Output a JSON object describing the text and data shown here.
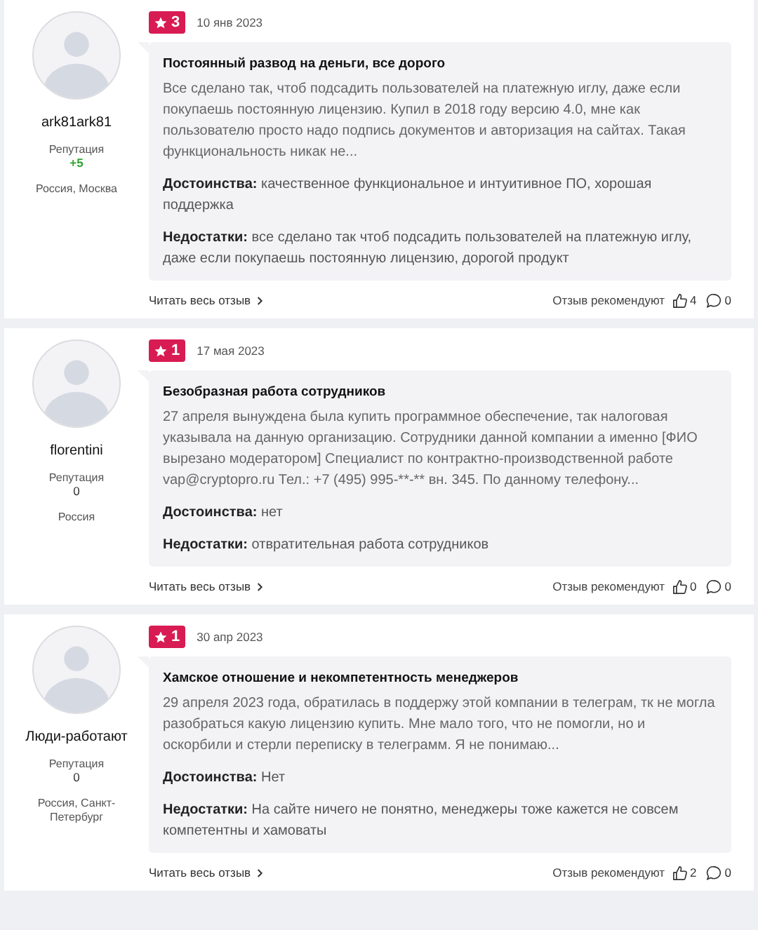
{
  "reviews": [
    {
      "author": "ark81ark81",
      "reputation_label": "Репутация",
      "reputation": "+5",
      "reputation_positive": true,
      "location": "Россия, Москва",
      "rating": "3",
      "date": "10 янв 2023",
      "title": "Постоянный развод на деньги, все дорого",
      "text": "Все сделано так, чтоб подсадить пользователей на платежную иглу, даже если покупаешь постоянную лицензию. Купил в 2018 году версию 4.0, мне как пользователю просто надо подпись документов и авторизация на сайтах. Такая функциональность никак не...",
      "pros": "**Достоинства:** качественное функциональное и интуитивное ПО, хорошая поддержка",
      "cons": "**Недостатки:** все сделано так чтоб подсадить пользователей на платежную иглу, даже если покупаешь постоянную лицензию, дорогой продукт",
      "read_more": "Читать весь отзыв",
      "recommend_label": "Отзыв рекомендуют",
      "likes": "4",
      "comments": "0"
    },
    {
      "author": "florentini",
      "reputation_label": "Репутация",
      "reputation": "0",
      "reputation_positive": false,
      "location": "Россия",
      "rating": "1",
      "date": "17 мая 2023",
      "title": "Безобразная работа сотрудников",
      "text": "27 апреля вынуждена была купить программное обеспечение, так налоговая указывала на данную организацию. Сотрудники данной компании а именно [ФИО вырезано модератором] Специалист по контрактно-производственной работе vap@cryptopro.ru Тел.: +7 (495) 995-**-** вн. 345. По данному телефону...",
      "pros": "**Достоинства:** нет",
      "cons": "**Недостатки:** отвратительная работа сотрудников",
      "read_more": "Читать весь отзыв",
      "recommend_label": "Отзыв рекомендуют",
      "likes": "0",
      "comments": "0"
    },
    {
      "author": "Люди-работают",
      "reputation_label": "Репутация",
      "reputation": "0",
      "reputation_positive": false,
      "location": "Россия, Санкт-Петербург",
      "rating": "1",
      "date": "30 апр 2023",
      "title": "Хамское отношение и некомпетентность менеджеров",
      "text": "29 апреля 2023 года, обратилась в поддержу этой компании в телеграм, тк не могла разобраться какую лицензию купить. Мне мало того, что не помогли, но и оскорбили и стерли переписку в телеграмм. Я не понимаю...",
      "pros": "**Достоинства:** Нет",
      "cons": "**Недостатки:** На сайте ничего не понятно, менеджеры тоже кажется не совсем компетентны и хамоваты",
      "read_more": "Читать весь отзыв",
      "recommend_label": "Отзыв рекомендуют",
      "likes": "2",
      "comments": "0"
    }
  ]
}
